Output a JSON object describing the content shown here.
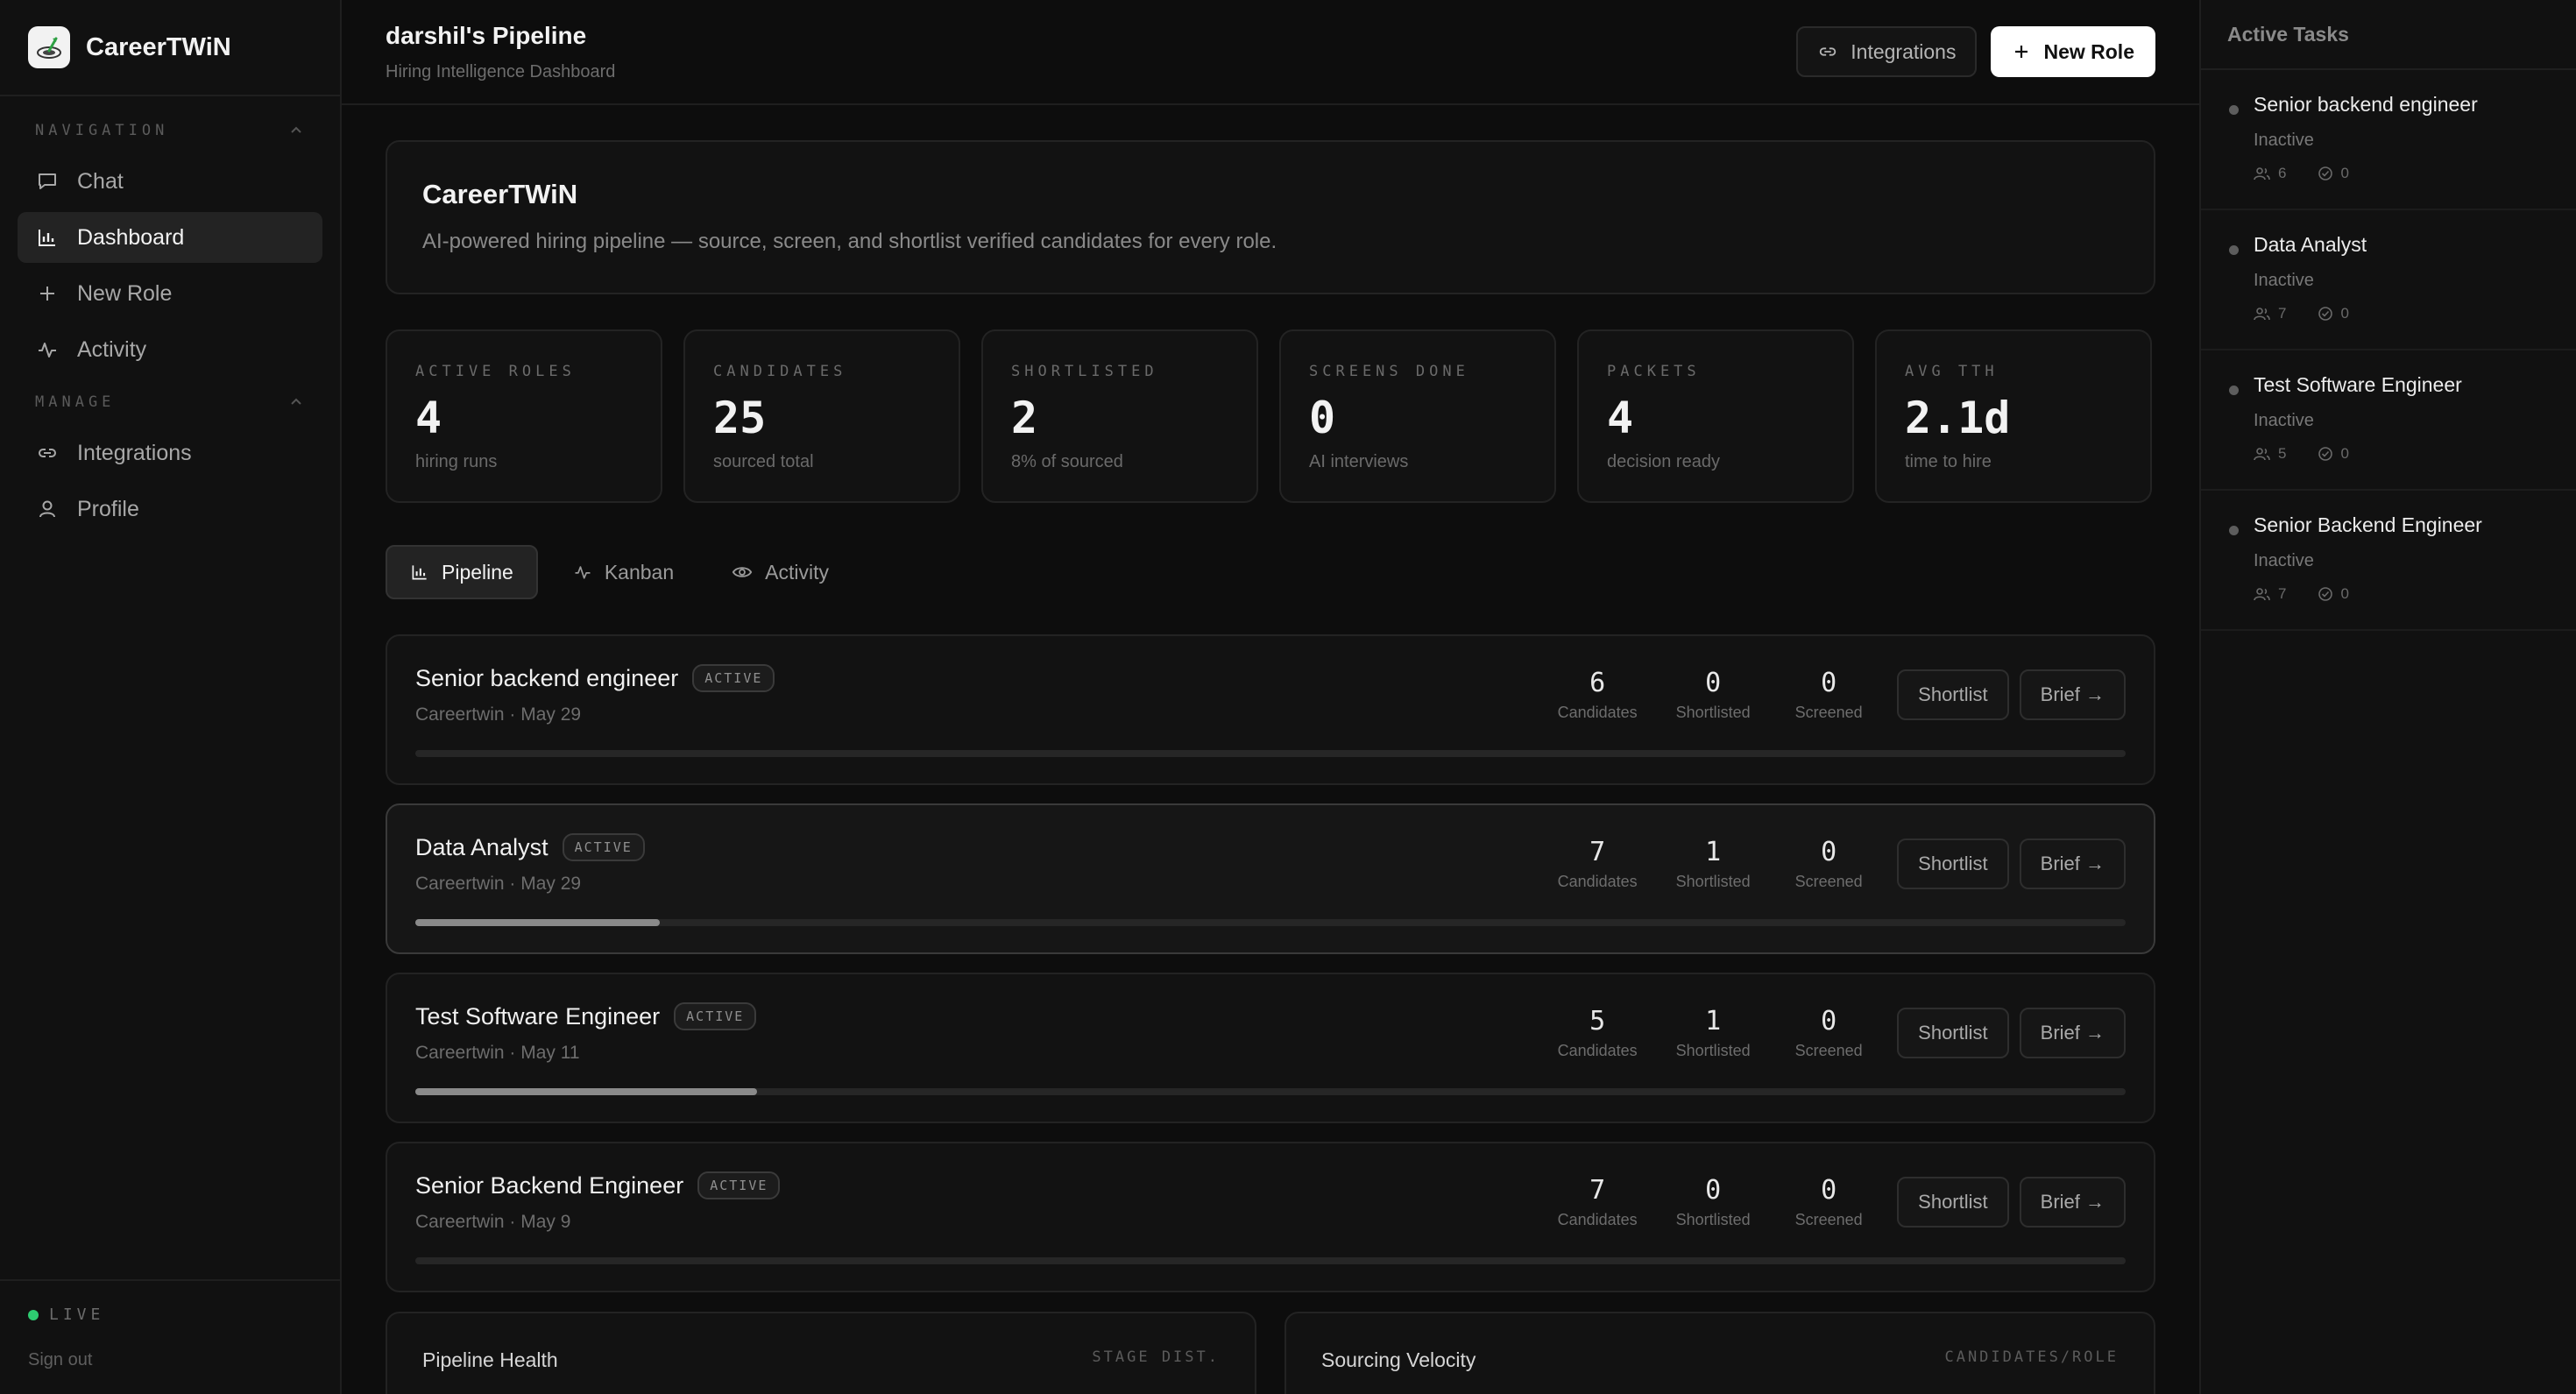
{
  "brand": {
    "name": "CareerTWiN"
  },
  "sidebar": {
    "navigation_label": "NAVIGATION",
    "manage_label": "MANAGE",
    "nav_items": [
      {
        "label": "Chat",
        "icon": "chat-icon"
      },
      {
        "label": "Dashboard",
        "icon": "bar-chart-icon",
        "active": true
      },
      {
        "label": "New Role",
        "icon": "plus-icon"
      },
      {
        "label": "Activity",
        "icon": "activity-icon"
      }
    ],
    "manage_items": [
      {
        "label": "Integrations",
        "icon": "link-icon"
      },
      {
        "label": "Profile",
        "icon": "user-icon"
      }
    ],
    "status": "LIVE",
    "status_color": "#2ecc71",
    "sign_out": "Sign out"
  },
  "header": {
    "title": "darshil's Pipeline",
    "subtitle": "Hiring Intelligence Dashboard",
    "integrations_label": "Integrations",
    "new_role_label": "New Role"
  },
  "hero": {
    "title": "CareerTWiN",
    "description": "AI-powered hiring pipeline — source, screen, and shortlist verified candidates for every role."
  },
  "stats": [
    {
      "label": "ACTIVE ROLES",
      "value": "4",
      "sub": "hiring runs"
    },
    {
      "label": "CANDIDATES",
      "value": "25",
      "sub": "sourced total"
    },
    {
      "label": "SHORTLISTED",
      "value": "2",
      "sub": "8% of sourced"
    },
    {
      "label": "SCREENS DONE",
      "value": "0",
      "sub": "AI interviews"
    },
    {
      "label": "PACKETS",
      "value": "4",
      "sub": "decision ready"
    },
    {
      "label": "AVG TTH",
      "value": "2.1d",
      "sub": "time to hire"
    }
  ],
  "tabs": [
    {
      "label": "Pipeline",
      "icon": "bar-chart-icon",
      "active": true
    },
    {
      "label": "Kanban",
      "icon": "activity-icon"
    },
    {
      "label": "Activity",
      "icon": "eye-icon"
    }
  ],
  "roles": [
    {
      "name": "Senior backend engineer",
      "badge": "ACTIVE",
      "meta": "Careertwin · May 29",
      "candidates": "6",
      "shortlisted": "0",
      "screened": "0",
      "progress": 0
    },
    {
      "name": "Data Analyst",
      "badge": "ACTIVE",
      "meta": "Careertwin · May 29",
      "candidates": "7",
      "shortlisted": "1",
      "screened": "0",
      "progress": 0.143
    },
    {
      "name": "Test Software Engineer",
      "badge": "ACTIVE",
      "meta": "Careertwin · May 11",
      "candidates": "5",
      "shortlisted": "1",
      "screened": "0",
      "progress": 0.2
    },
    {
      "name": "Senior Backend Engineer",
      "badge": "ACTIVE",
      "meta": "Careertwin · May 9",
      "candidates": "7",
      "shortlisted": "0",
      "screened": "0",
      "progress": 0
    }
  ],
  "role_labels": {
    "candidates": "Candidates",
    "shortlisted": "Shortlisted",
    "screened": "Screened",
    "shortlist_button": "Shortlist",
    "brief_button": "Brief →"
  },
  "panels": [
    {
      "title": "Pipeline Health",
      "tag": "STAGE DIST."
    },
    {
      "title": "Sourcing Velocity",
      "tag": "CANDIDATES/ROLE"
    }
  ],
  "tasks": {
    "title": "Active Tasks",
    "items": [
      {
        "title": "Senior backend engineer",
        "status": "Inactive",
        "people": "6",
        "done": "0"
      },
      {
        "title": "Data Analyst",
        "status": "Inactive",
        "people": "7",
        "done": "0"
      },
      {
        "title": "Test Software Engineer",
        "status": "Inactive",
        "people": "5",
        "done": "0"
      },
      {
        "title": "Senior Backend Engineer",
        "status": "Inactive",
        "people": "7",
        "done": "0"
      }
    ]
  }
}
